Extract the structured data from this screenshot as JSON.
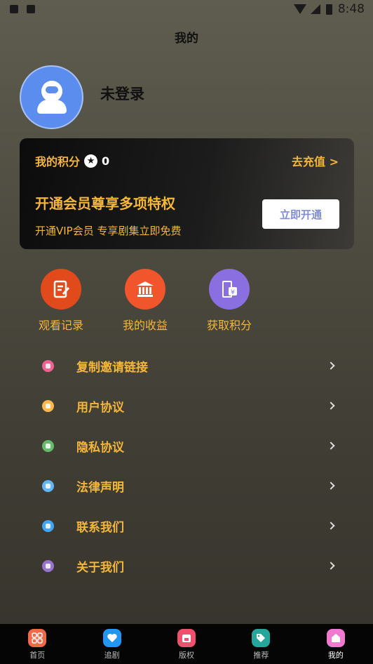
{
  "status_bar": {
    "time": "8:48"
  },
  "header": {
    "title": "我的"
  },
  "profile": {
    "username": "未登录"
  },
  "vip_card": {
    "points_label": "我的积分",
    "points_value": "0",
    "recharge_label": "去充值 >",
    "headline": "开通会员尊享多项特权",
    "subtext": "开通VIP会员 专享剧集立即免费",
    "open_button": "立即开通"
  },
  "quick_actions": [
    {
      "label": "观看记录",
      "icon": "edit-icon",
      "color": "#e14a1a"
    },
    {
      "label": "我的收益",
      "icon": "bank-icon",
      "color": "#f0552c"
    },
    {
      "label": "获取积分",
      "icon": "coin-icon",
      "color": "#8a6fe0"
    }
  ],
  "menu": [
    {
      "label": "复制邀请链接",
      "icon": "tag-icon",
      "color": "#f06292"
    },
    {
      "label": "用户协议",
      "icon": "document-icon",
      "color": "#ffb74d"
    },
    {
      "label": "隐私协议",
      "icon": "lock-icon",
      "color": "#66bb6a"
    },
    {
      "label": "法律声明",
      "icon": "flag-icon",
      "color": "#64b5f6"
    },
    {
      "label": "联系我们",
      "icon": "phone-icon",
      "color": "#42a5f5"
    },
    {
      "label": "关于我们",
      "icon": "info-icon",
      "color": "#9575cd"
    }
  ],
  "tabbar": [
    {
      "label": "首页",
      "icon": "home-grid-icon",
      "color": "#f06a4a"
    },
    {
      "label": "追剧",
      "icon": "heart-icon",
      "color": "#2196f3"
    },
    {
      "label": "版权",
      "icon": "shop-icon",
      "color": "#f0506e"
    },
    {
      "label": "推荐",
      "icon": "tag-icon",
      "color": "#26a69a"
    },
    {
      "label": "我的",
      "icon": "house-icon",
      "color": "#f07ad0",
      "active": true
    }
  ]
}
